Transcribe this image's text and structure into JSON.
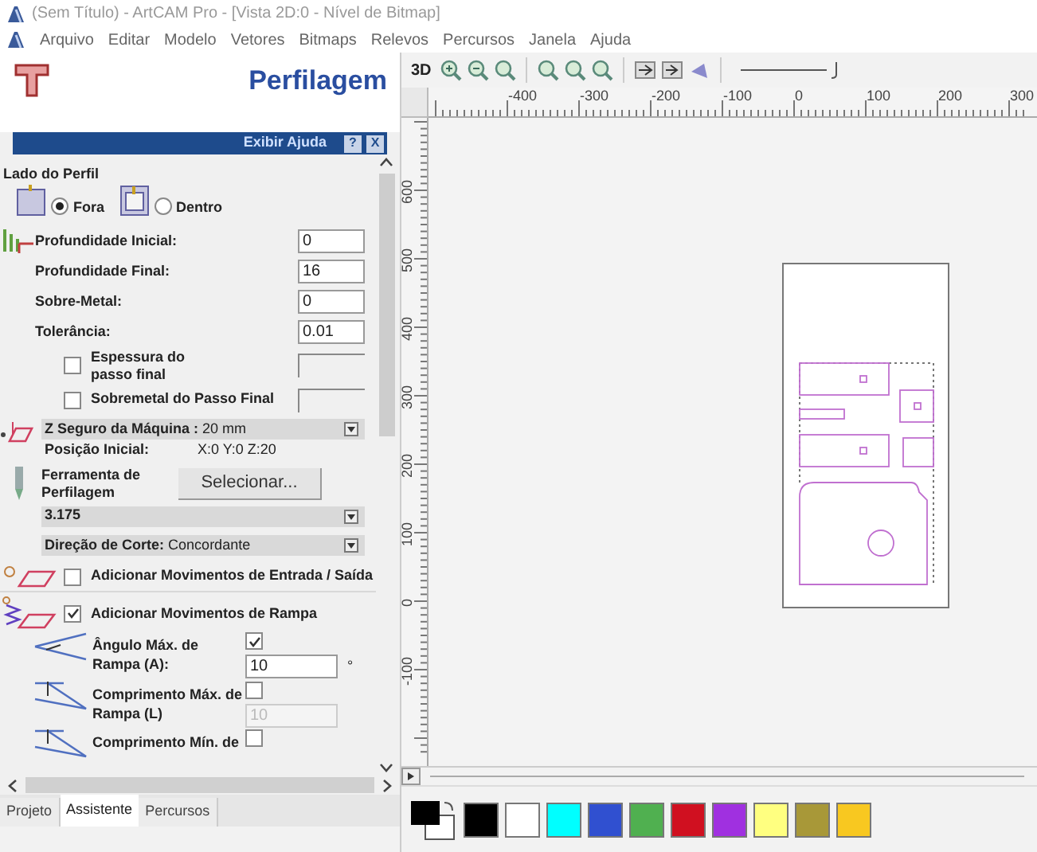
{
  "window": {
    "title": "(Sem Título) - ArtCAM Pro - [Vista 2D:0 - Nível de Bitmap]"
  },
  "menu": [
    "Arquivo",
    "Editar",
    "Modelo",
    "Vetores",
    "Bitmaps",
    "Relevos",
    "Percursos",
    "Janela",
    "Ajuda"
  ],
  "panel": {
    "title": "Perfilagem",
    "help_bar": {
      "label": "Exibir Ajuda",
      "buttons": [
        "?",
        "X"
      ]
    },
    "profile_side": {
      "label": "Lado do Perfil",
      "options": [
        {
          "label": "Fora",
          "selected": true
        },
        {
          "label": "Dentro",
          "selected": false
        }
      ]
    },
    "depth_fields": [
      {
        "label": "Profundidade Inicial:",
        "value": "0"
      },
      {
        "label": "Profundidade Final:",
        "value": "16"
      },
      {
        "label": "Sobre-Metal:",
        "value": "0"
      },
      {
        "label": "Tolerância:",
        "value": "0.01"
      }
    ],
    "options": [
      {
        "label": "Espessura do passo final",
        "checked": false
      },
      {
        "label": "Sobremetal do Passo Final",
        "checked": false
      }
    ],
    "safe_z": {
      "label": "Z Seguro da Máquina :",
      "value": "20 mm"
    },
    "start_position": {
      "label": "Posição Inicial:",
      "value": "X:0 Y:0 Z:20"
    },
    "tool": {
      "label": "Ferramenta de Perfilagem",
      "button": "Selecionar...",
      "value": "3.175"
    },
    "cut_direction": {
      "label": "Direção de Corte:",
      "value": "Concordante"
    },
    "lead_moves": {
      "label": "Adicionar Movimentos de Entrada / Saída",
      "checked": false
    },
    "ramp_moves": {
      "label": "Adicionar Movimentos de Rampa",
      "checked": true,
      "params": [
        {
          "label": "Ângulo Máx. de Rampa  (A):",
          "checked": true,
          "value": "10",
          "unit": "°",
          "disabled": false
        },
        {
          "label": "Comprimento Máx. de Rampa (L)",
          "checked": false,
          "value": "10",
          "disabled": true
        },
        {
          "label": "Comprimento Mín. de",
          "checked": false
        }
      ]
    },
    "tabs": [
      {
        "label": "Projeto",
        "selected": false
      },
      {
        "label": "Assistente",
        "selected": true
      },
      {
        "label": "Percursos",
        "selected": false
      }
    ]
  },
  "toolbar": {
    "view_label": "3D"
  },
  "ruler": {
    "x_labels": [
      "-400",
      "-300",
      "-200",
      "-100",
      "0",
      "100",
      "200",
      "300"
    ],
    "y_labels": [
      "600",
      "500",
      "400",
      "300",
      "200",
      "100",
      "0",
      "-100"
    ]
  },
  "palette": {
    "colors": [
      {
        "color": "#000000"
      },
      {
        "color": "#ffffff"
      },
      {
        "color": "#00ffff"
      },
      {
        "color": "#3050d0"
      },
      {
        "color": "#50b050"
      },
      {
        "color": "#d01020"
      },
      {
        "color": "#a030e0"
      },
      {
        "color": "#ffff80"
      },
      {
        "color": "#a89838"
      },
      {
        "color": "#f8c820"
      }
    ]
  }
}
